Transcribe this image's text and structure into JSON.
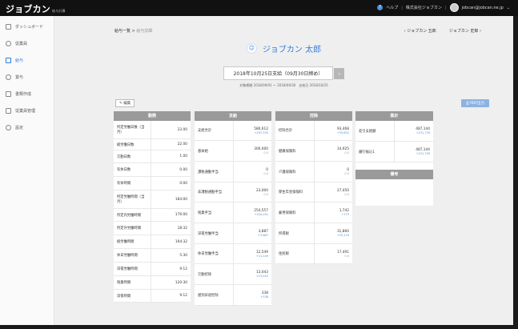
{
  "header": {
    "logo": "ジョブカン",
    "logo_sub": "給与計算",
    "help": "ヘルプ",
    "company": "株式会社ジョブカン",
    "user_email": "jobcan@jobcan.ne.jp"
  },
  "sidebar": {
    "items": [
      {
        "label": "ダッシュボード",
        "icon": "grid-icon"
      },
      {
        "label": "従業員",
        "icon": "person-icon"
      },
      {
        "label": "給与",
        "icon": "document-icon"
      },
      {
        "label": "賞与",
        "icon": "coin-icon"
      },
      {
        "label": "書類作成",
        "icon": "edit-icon"
      },
      {
        "label": "従業員管理",
        "icon": "people-icon"
      },
      {
        "label": "設定",
        "icon": "gear-icon"
      }
    ]
  },
  "breadcrumb": {
    "list": "給与一覧",
    "sep": ">",
    "current": "給与詳細"
  },
  "nav": {
    "prev": "‹ ジョブカン 五郎",
    "next": "ジョブカン 史郎 ›"
  },
  "employee": {
    "name": "ジョブカン 太郎"
  },
  "payday": {
    "label": "2018年10月25日支給（09月30日締め）",
    "btn": "⌄"
  },
  "period": "対象期間 2018/09/01 〜 2018/09/30　支給日 2018/10/25",
  "actions": {
    "edit": "✎ 編集",
    "pdf": "⎙ PDF出力"
  },
  "sections": {
    "attendance": {
      "title": "勤務",
      "rows": [
        {
          "label": "所定労働日数（当月）",
          "value": "23.00"
        },
        {
          "label": "総労働日数",
          "value": "22.00"
        },
        {
          "label": "欠勤日数",
          "value": "1.00"
        },
        {
          "label": "有休日数",
          "value": "0.00"
        },
        {
          "label": "有休時間",
          "value": "0:00"
        },
        {
          "label": "所定労働時間（当月）",
          "value": "184:00"
        },
        {
          "label": "所定内労働時間",
          "value": "176:00"
        },
        {
          "label": "所定外労働時間",
          "value": "18:32"
        },
        {
          "label": "総労働時間",
          "value": "194:32"
        },
        {
          "label": "休日労働時間",
          "value": "5:30"
        },
        {
          "label": "深夜労働時間",
          "value": "9:12"
        },
        {
          "label": "残業時間",
          "value": "120:30"
        },
        {
          "label": "深夜時間",
          "value": "9:12"
        }
      ]
    },
    "payment": {
      "title": "支給",
      "rows": [
        {
          "label": "支給合計",
          "value": "580,612",
          "sub": "+297,535"
        },
        {
          "label": "基本給",
          "value": "300,000",
          "sub": "0.0"
        },
        {
          "label": "課税通勤手当",
          "value": "0",
          "sub": "0.0"
        },
        {
          "label": "非課税通勤手当",
          "value": "23,000",
          "sub": "0.0"
        },
        {
          "label": "残業手当",
          "value": "254,557",
          "sub": "+254,251"
        },
        {
          "label": "深夜労働手当",
          "value": "3,887",
          "sub": "+3,887"
        },
        {
          "label": "休日労働手当",
          "value": "12,549",
          "sub": "+11,149"
        },
        {
          "label": "欠勤控除",
          "value": "13,043",
          "sub": "+13,043"
        },
        {
          "label": "遅刻早退控除",
          "value": "338",
          "sub": "+338"
        }
      ]
    },
    "deduction": {
      "title": "控除",
      "rows": [
        {
          "label": "控除合計",
          "value": "93,468",
          "sub": "+35,802"
        },
        {
          "label": "健康保険料",
          "value": "14,925",
          "sub": "0.0"
        },
        {
          "label": "介護保険料",
          "value": "0",
          "sub": "0.0"
        },
        {
          "label": "厚生年金保険料",
          "value": "27,450",
          "sub": "0.0"
        },
        {
          "label": "雇用保険料",
          "value": "1,742",
          "sub": "+773"
        },
        {
          "label": "所得税",
          "value": "31,860",
          "sub": "+25,134"
        },
        {
          "label": "住民税",
          "value": "17,491",
          "sub": "0.0"
        }
      ]
    },
    "totals": {
      "title": "集計",
      "rows": [
        {
          "label": "差引支給額",
          "value": "487,144",
          "sub": "+231,739"
        },
        {
          "label": "銀行振込1",
          "value": "487,144",
          "sub": "+231,739"
        }
      ],
      "remarks_title": "備考"
    }
  }
}
